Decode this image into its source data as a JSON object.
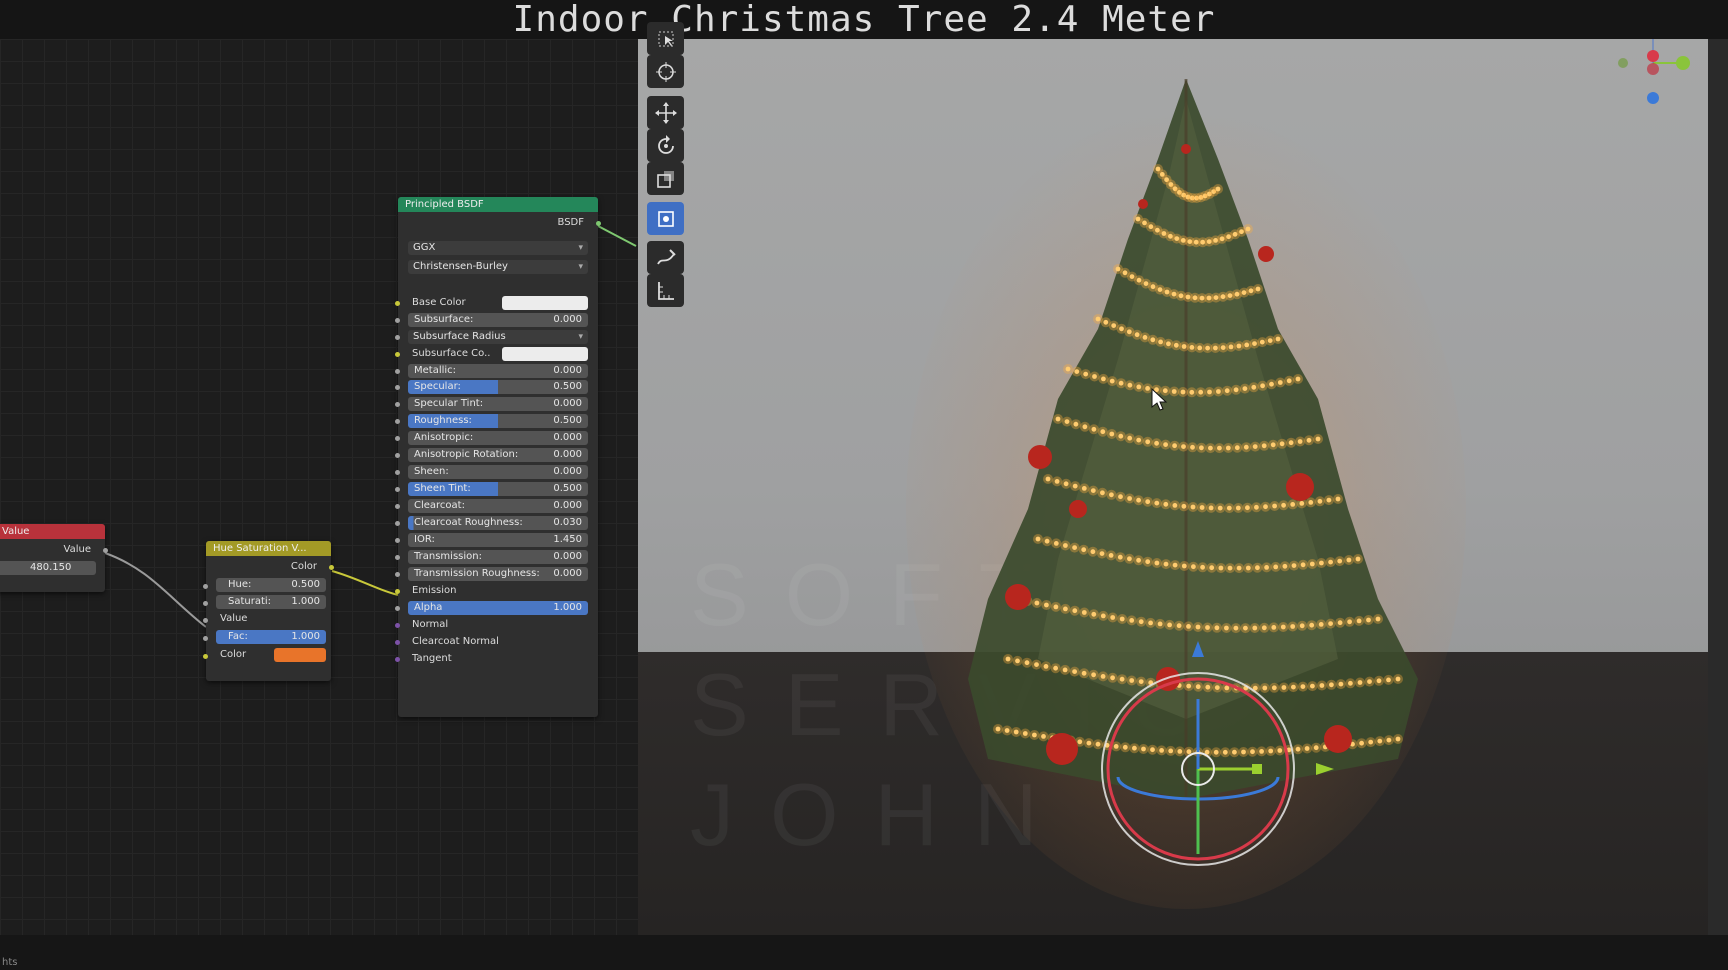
{
  "title": "Indoor Christmas Tree 2.4 Meter",
  "status_text": "hts",
  "value_node": {
    "header": "Value",
    "output": "Value",
    "value": "480.150"
  },
  "hue_node": {
    "header": "Hue Saturation V...",
    "output": "Color",
    "hue_label": "Hue:",
    "hue_value": "0.500",
    "sat_label": "Saturati:",
    "sat_value": "1.000",
    "value_label": "Value",
    "fac_label": "Fac:",
    "fac_value": "1.000",
    "color_label": "Color",
    "color_hex": "#e8742a"
  },
  "bsdf": {
    "header": "Principled BSDF",
    "output": "BSDF",
    "distribution": "GGX",
    "subsurface_method": "Christensen-Burley",
    "rows": [
      {
        "label": "Base Color",
        "kind": "color"
      },
      {
        "label": "Subsurface:",
        "value": "0.000",
        "kind": "field"
      },
      {
        "label": "Subsurface Radius",
        "kind": "dropdown"
      },
      {
        "label": "Subsurface Co..",
        "kind": "color"
      },
      {
        "label": "Metallic:",
        "value": "0.000",
        "kind": "field"
      },
      {
        "label": "Specular:",
        "value": "0.500",
        "kind": "field",
        "fill": 0.5
      },
      {
        "label": "Specular Tint:",
        "value": "0.000",
        "kind": "field"
      },
      {
        "label": "Roughness:",
        "value": "0.500",
        "kind": "field",
        "fill": 0.5
      },
      {
        "label": "Anisotropic:",
        "value": "0.000",
        "kind": "field"
      },
      {
        "label": "Anisotropic Rotation:",
        "value": "0.000",
        "kind": "field"
      },
      {
        "label": "Sheen:",
        "value": "0.000",
        "kind": "field"
      },
      {
        "label": "Sheen Tint:",
        "value": "0.500",
        "kind": "field",
        "fill": 0.5
      },
      {
        "label": "Clearcoat:",
        "value": "0.000",
        "kind": "field"
      },
      {
        "label": "Clearcoat Roughness:",
        "value": "0.030",
        "kind": "field",
        "fill": 0.03
      },
      {
        "label": "IOR:",
        "value": "1.450",
        "kind": "field"
      },
      {
        "label": "Transmission:",
        "value": "0.000",
        "kind": "field"
      },
      {
        "label": "Transmission Roughness:",
        "value": "0.000",
        "kind": "field"
      },
      {
        "label": "Emission",
        "kind": "text"
      },
      {
        "label": "Alpha",
        "value": "1.000",
        "kind": "field",
        "fill": 1.0
      },
      {
        "label": "Normal",
        "kind": "text"
      },
      {
        "label": "Clearcoat Normal",
        "kind": "text"
      },
      {
        "label": "Tangent",
        "kind": "text"
      }
    ]
  },
  "watermark": [
    "SOFTW",
    "SERVIC",
    "JOHN"
  ],
  "toolbar": [
    "select-box-icon",
    "cursor-icon",
    "move-icon",
    "rotate-icon",
    "scale-icon",
    "transform-icon",
    "annotate-icon",
    "measure-icon"
  ]
}
